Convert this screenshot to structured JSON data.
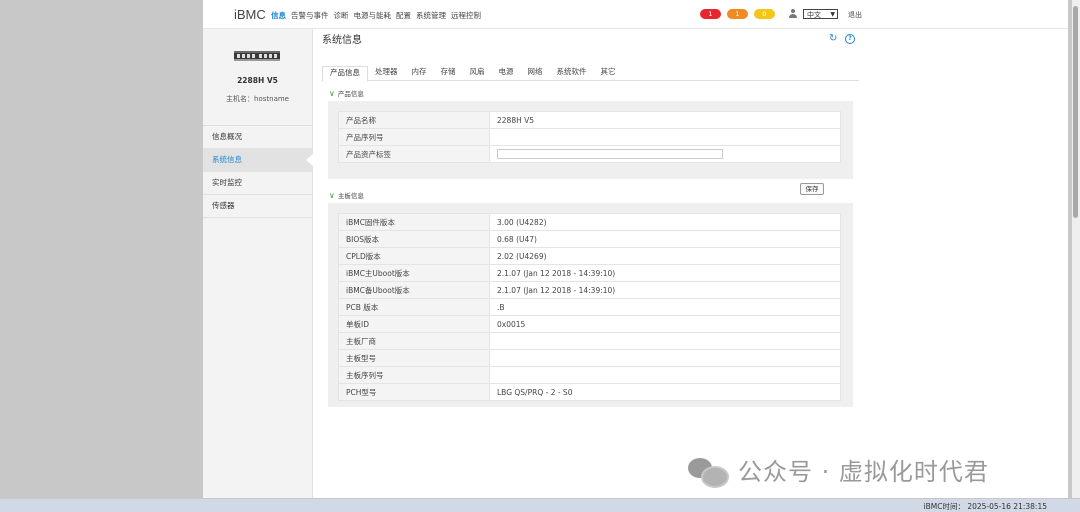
{
  "topbar": {
    "brand": "iBMC",
    "nav": [
      "信息",
      "告警与事件",
      "诊断",
      "电源与能耗",
      "配置",
      "系统管理",
      "远程控制"
    ],
    "alerts": {
      "critical": "1",
      "major": "1",
      "minor": "0"
    },
    "language": "中文",
    "logout": "退出"
  },
  "sidebar": {
    "model": "2288H V5",
    "hostname": "主机名：hostname",
    "menu": [
      "信息概况",
      "系统信息",
      "实时监控",
      "传感器"
    ]
  },
  "main": {
    "title": "系统信息",
    "tabs": [
      "产品信息",
      "处理器",
      "内存",
      "存储",
      "风扇",
      "电源",
      "网络",
      "系统软件",
      "其它"
    ],
    "product": {
      "section_title": "产品信息",
      "rows": [
        {
          "label": "产品名称",
          "value": "2288H V5"
        },
        {
          "label": "产品序列号",
          "value": ""
        },
        {
          "label": "产品资产标签",
          "value": ""
        }
      ],
      "save_label": "保存"
    },
    "board": {
      "section_title": "主板信息",
      "rows": [
        {
          "label": "iBMC固件版本",
          "value": "3.00 (U4282)"
        },
        {
          "label": "BIOS版本",
          "value": "0.68 (U47)"
        },
        {
          "label": "CPLD版本",
          "value": "2.02 (U4269)"
        },
        {
          "label": "iBMC主Uboot版本",
          "value": "2.1.07 (Jan 12 2018 - 14:39:10)"
        },
        {
          "label": "iBMC备Uboot版本",
          "value": "2.1.07 (Jan 12 2018 - 14:39:10)"
        },
        {
          "label": "PCB 版本",
          "value": ".B"
        },
        {
          "label": "单板ID",
          "value": "0x0015"
        },
        {
          "label": "主板厂商",
          "value": ""
        },
        {
          "label": "主板型号",
          "value": ""
        },
        {
          "label": "主板序列号",
          "value": ""
        },
        {
          "label": "PCH型号",
          "value": "LBG QS/PRQ - 2 - S0"
        }
      ]
    }
  },
  "statusbar": {
    "time": "iBMC时间： 2025-05-16 21:38:15"
  },
  "watermark": "公众号 · 虚拟化时代君",
  "colors": {
    "accent": "#1f86d6",
    "critical": "#e8272c",
    "major": "#f08a21",
    "minor": "#f5c518"
  },
  "icons": [
    "refresh-icon",
    "help-icon",
    "user-icon",
    "chevron-down-icon",
    "server-image",
    "wechat-icon"
  ]
}
